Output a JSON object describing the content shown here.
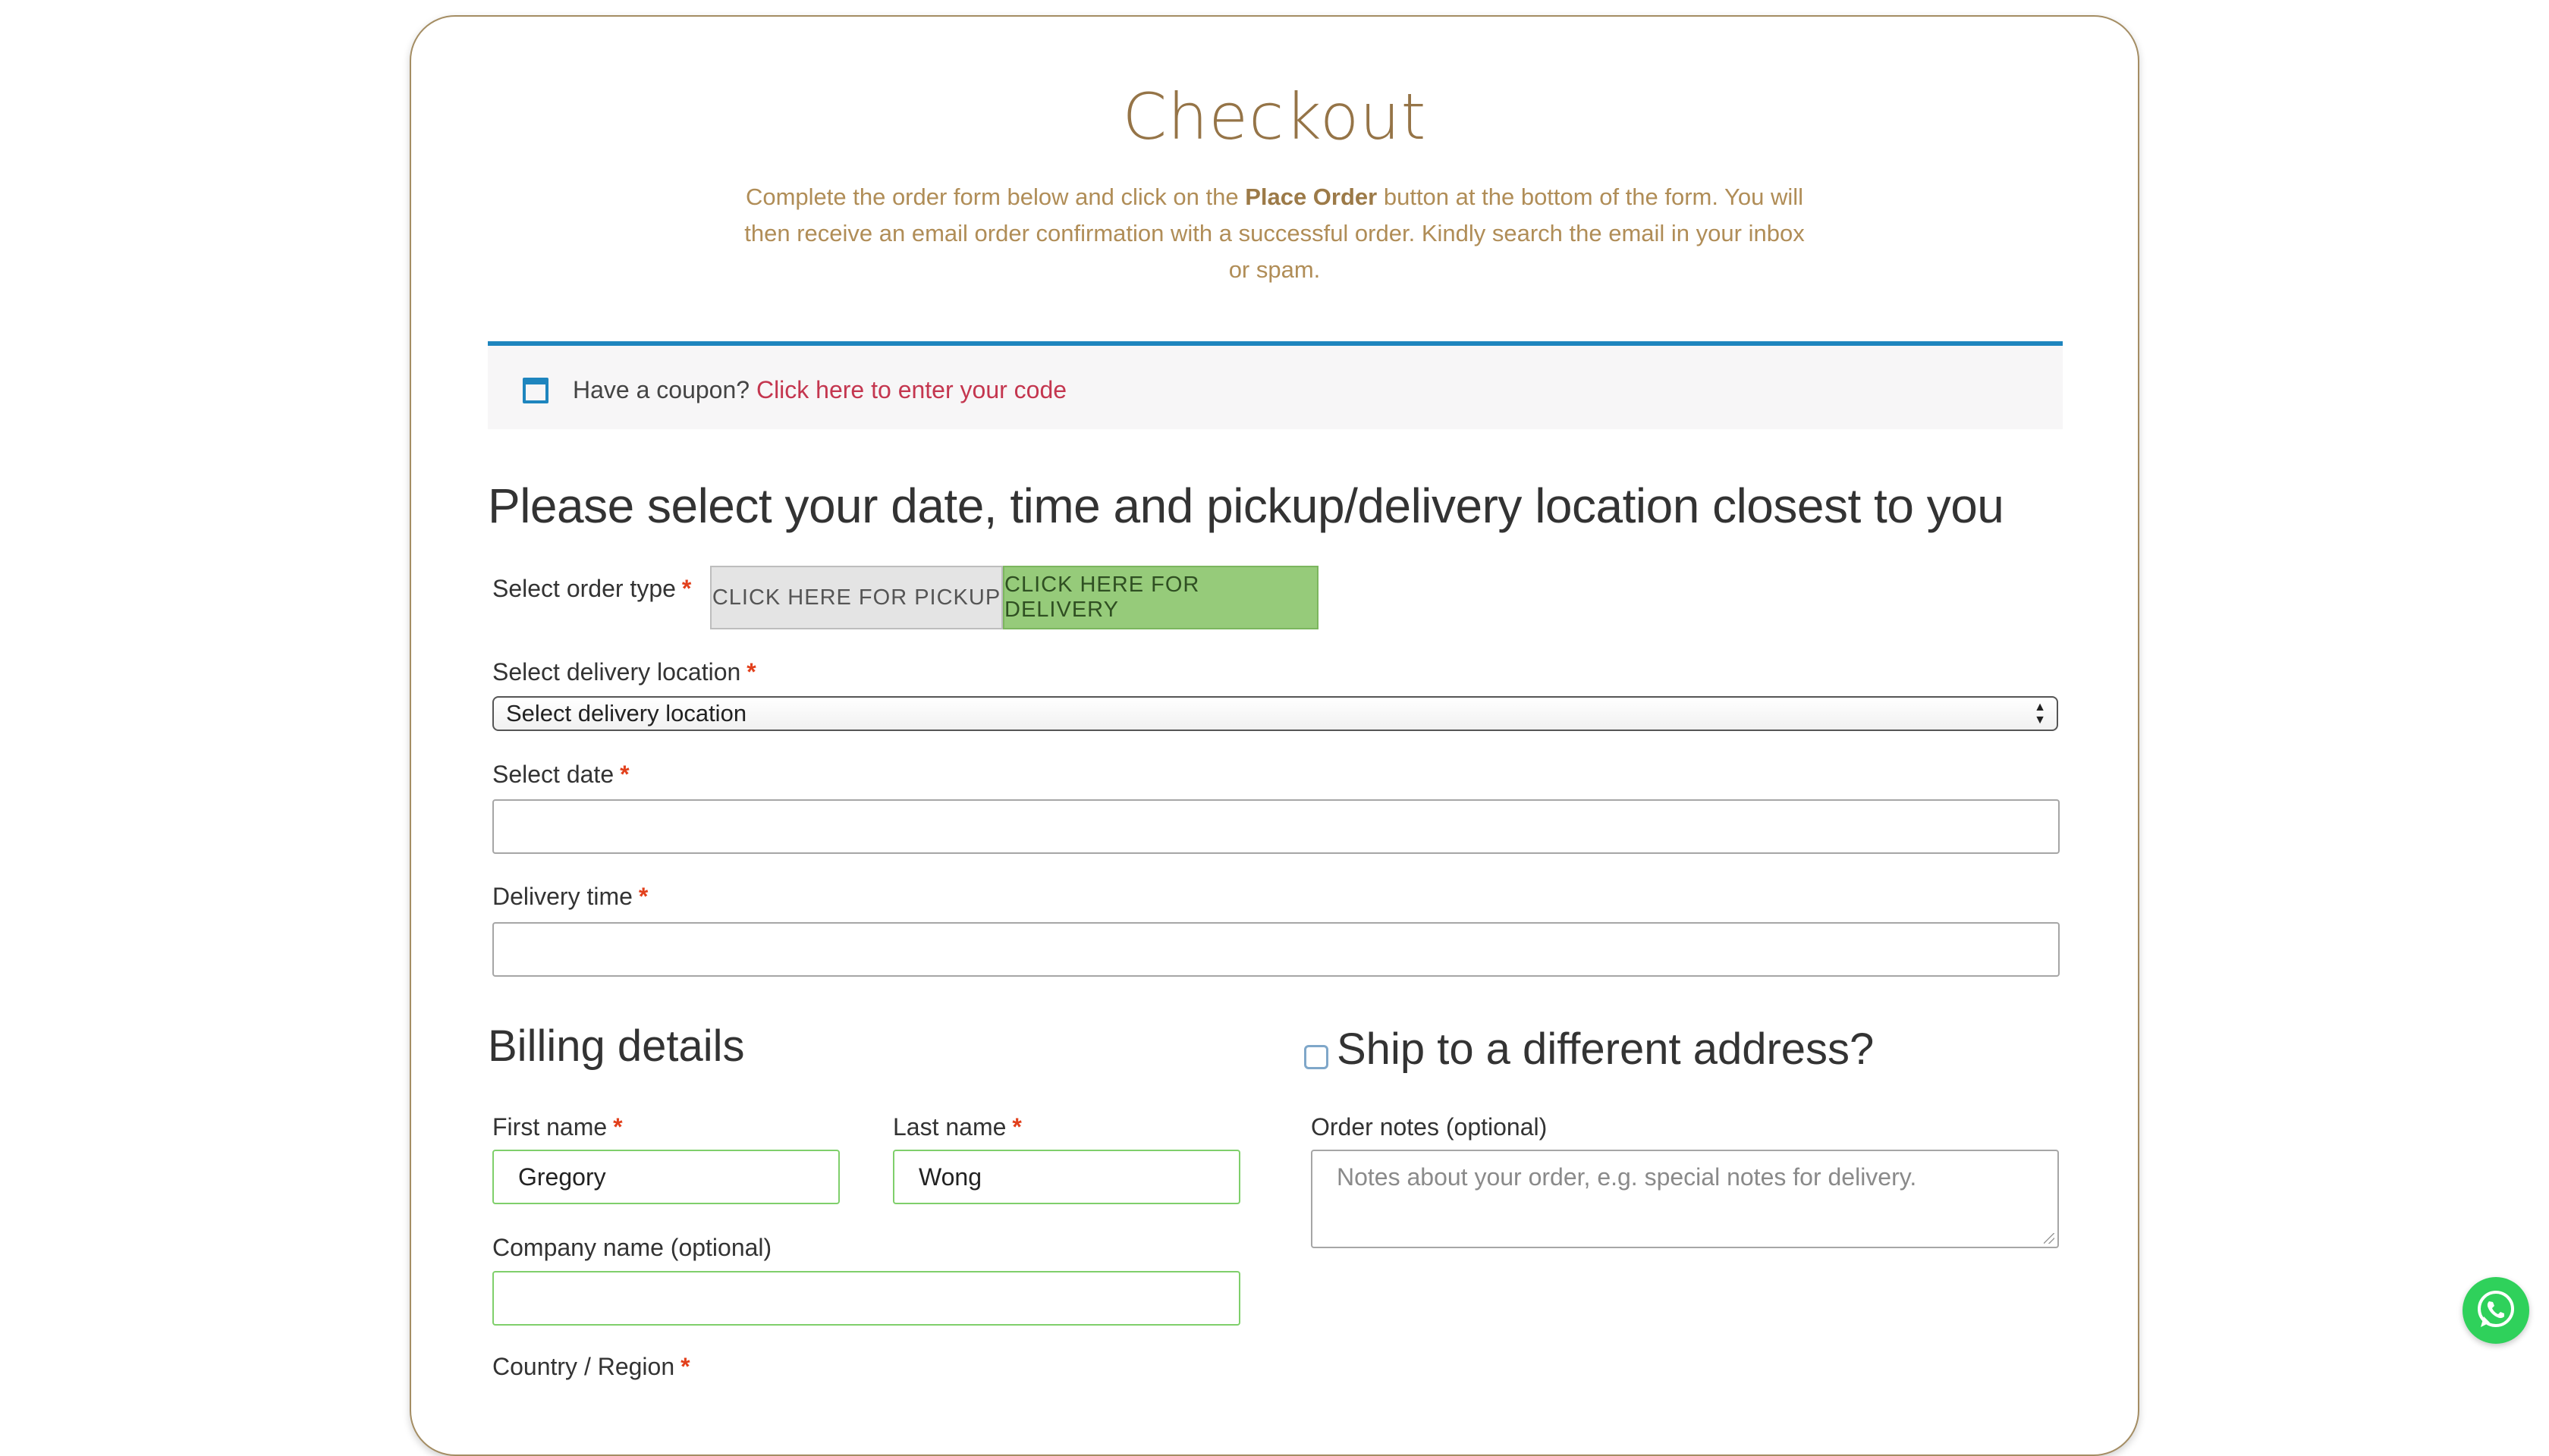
{
  "header": {
    "title": "Checkout",
    "intro_part1": "Complete the order form below and click on the ",
    "intro_bold": "Place Order",
    "intro_part2": " button at the bottom of the form. You will then receive an email order confirmation with a successful order. Kindly search the email in your inbox or spam."
  },
  "coupon": {
    "prompt": "Have a coupon?",
    "link": "Click here to enter your code"
  },
  "order_section": {
    "heading": "Please select your date, time and pickup/delivery location closest to you",
    "order_type_label": "Select order type",
    "pickup_button": "CLICK HERE FOR PICKUP",
    "delivery_button": "CLICK HERE FOR DELIVERY",
    "delivery_location_label": "Select delivery location",
    "delivery_location_selected": "Select delivery location",
    "date_label": "Select date",
    "date_value": "",
    "time_label": "Delivery time",
    "time_value": "",
    "required_marker": "*"
  },
  "billing": {
    "heading": "Billing details",
    "first_name_label": "First name",
    "first_name_value": "Gregory",
    "last_name_label": "Last name",
    "last_name_value": "Wong",
    "company_label": "Company name (optional)",
    "company_value": "",
    "country_label": "Country / Region"
  },
  "shipping": {
    "heading": "Ship to a different address?",
    "order_notes_label": "Order notes (optional)",
    "order_notes_placeholder": "Notes about your order, e.g. special notes for delivery."
  },
  "colors": {
    "accent_gold": "#957447",
    "coupon_border": "#1e85be",
    "coupon_link": "#c4364f",
    "delivery_green": "#96cb7a",
    "valid_border": "#7fcf6b",
    "required_red": "#e2401c",
    "whatsapp_green": "#2fd15b"
  },
  "icons": {
    "coupon": "calendar-window-icon",
    "whatsapp": "whatsapp-icon"
  }
}
